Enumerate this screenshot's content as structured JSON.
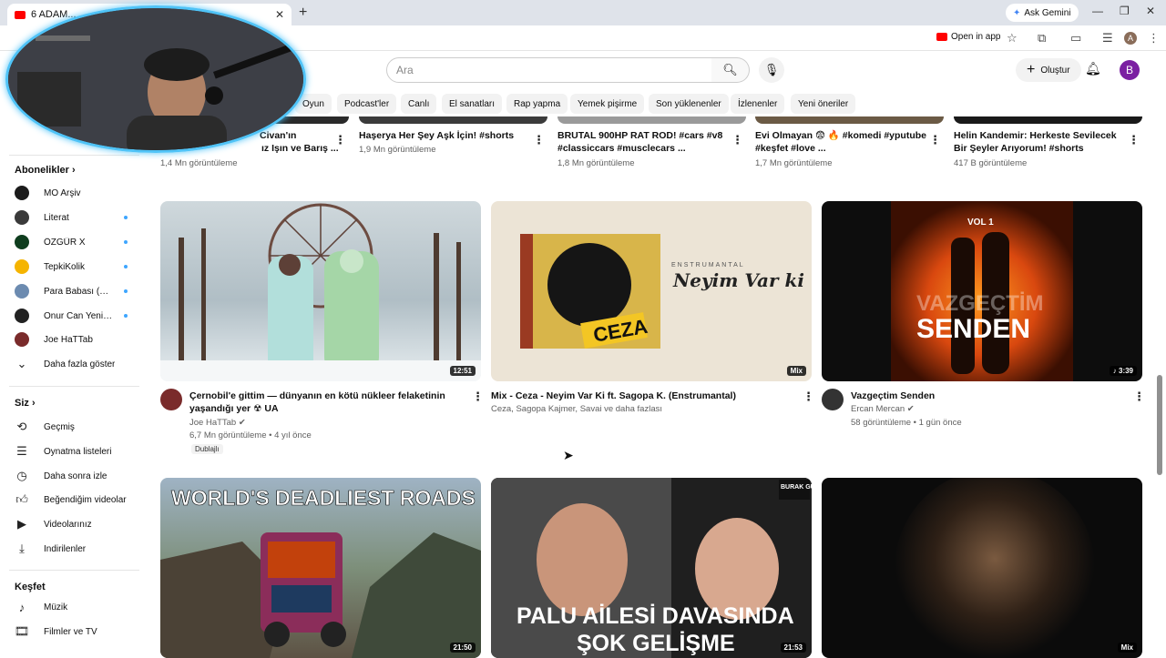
{
  "browser": {
    "tab_title": "6 ADAM...",
    "tab_close": "✕",
    "new_tab": "+",
    "gemini_label": "Ask Gemini",
    "open_in_app": "Open in app",
    "profile_initial": "A"
  },
  "header": {
    "search_placeholder": "Ara",
    "create_label": "Oluştur",
    "avatar_initial": "B"
  },
  "chips": [
    "Oyun",
    "Podcast'ler",
    "Canlı",
    "El sanatları",
    "Rap yapma",
    "Yemek pişirme",
    "Son yüklenenler",
    "İzlenenler",
    "Yeni öneriler"
  ],
  "sidebar": {
    "subscriptions_heading": "Abonelikler",
    "subscriptions": [
      {
        "name": "MO Arşiv",
        "color": "#1b1b1b",
        "new": false
      },
      {
        "name": "Literat",
        "color": "#3a3a3a",
        "new": true
      },
      {
        "name": "ÖZGÜR X",
        "color": "#0f3d1e",
        "new": true
      },
      {
        "name": "TepkiKolik",
        "color": "#f5b400",
        "new": true
      },
      {
        "name": "Para Babası (Sai...",
        "color": "#6c8bb0",
        "new": true
      },
      {
        "name": "Onur Can Yenilm...",
        "color": "#222222",
        "new": true
      },
      {
        "name": "Joe HaTTab",
        "color": "#7a2b2b",
        "new": false
      }
    ],
    "show_more": "Daha fazla göster",
    "you_heading": "Siz",
    "you_items": [
      {
        "label": "Geçmiş",
        "icon": "⟲"
      },
      {
        "label": "Oynatma listeleri",
        "icon": "☰"
      },
      {
        "label": "Daha sonra izle",
        "icon": "◷"
      },
      {
        "label": "Beğendiğim videolar",
        "icon": "👍"
      },
      {
        "label": "Videolarınız",
        "icon": "▶"
      },
      {
        "label": "İndirilenler",
        "icon": "⤓"
      }
    ],
    "explore_heading": "Keşfet",
    "explore_items": [
      {
        "label": "Müzik",
        "icon": "♪"
      },
      {
        "label": "Filmler ve TV",
        "icon": "🎬"
      }
    ]
  },
  "top_row": [
    {
      "title1": "Civan'ın",
      "title2": "ız Işın ve Barış ...",
      "meta": "1,4 Mn görüntüleme"
    },
    {
      "title1": "Haşerya Her Şey Aşk İçin! #shorts",
      "title2": "",
      "meta": "1,9 Mn görüntüleme"
    },
    {
      "title1": "BRUTAL 900HP RAT ROD! #cars #v8",
      "title2": "#classiccars #musclecars ...",
      "meta": "1,8 Mn görüntüleme"
    },
    {
      "title1": "Evi Olmayan 😨 🔥 #komedi #yputube",
      "title2": "#keşfet #love ...",
      "meta": "1,7 Mn görüntüleme"
    },
    {
      "title1": "Helin Kandemir: Herkeste Sevilecek",
      "title2": "Bir Şeyler Arıyorum! #shorts",
      "meta": "417 B görüntüleme"
    }
  ],
  "videos_row1": [
    {
      "title1": "Çernobil'e gittim — dünyanın en kötü nükleer felaketinin",
      "title2": "yaşandığı yer ☢ UA",
      "channel": "Joe HaTTab ✔",
      "meta": "6,7 Mn görüntüleme • 4 yıl önce",
      "badge": "Dublajlı",
      "duration": "12:51"
    },
    {
      "title1": "Mix - Ceza - Neyim Var Ki ft. Sagopa K. (Enstrumantal)",
      "title2": "",
      "channel": "Ceza, Sagopa Kajmer, Savai ve daha fazlası",
      "meta": "",
      "badge": "",
      "duration": "Mix",
      "thumb_text1": "ENSTRUMANTAL",
      "thumb_text2": "Neyim Var ki",
      "thumb_text3": "CEZA"
    },
    {
      "title1": "Vazgeçtim Senden",
      "title2": "",
      "channel": "Ercan Mercan ✔",
      "meta": "58 görüntüleme • 1 gün önce",
      "badge": "",
      "duration": "♪ 3:39",
      "thumb_text1": "VOL 1",
      "thumb_text2": "VAZGEÇTİM",
      "thumb_text3": "SENDEN"
    }
  ],
  "videos_row2": [
    {
      "duration": "21:50",
      "thumb_text1": "WORLD'S DEADLIEST ROADS"
    },
    {
      "duration": "21:53",
      "thumb_text1": "PALU AİLESİ DAVASINDA",
      "thumb_text2": "ŞOK GELİŞME",
      "thumb_text3": "BURAK GÜNGÖR"
    },
    {
      "duration": "Mix"
    }
  ]
}
